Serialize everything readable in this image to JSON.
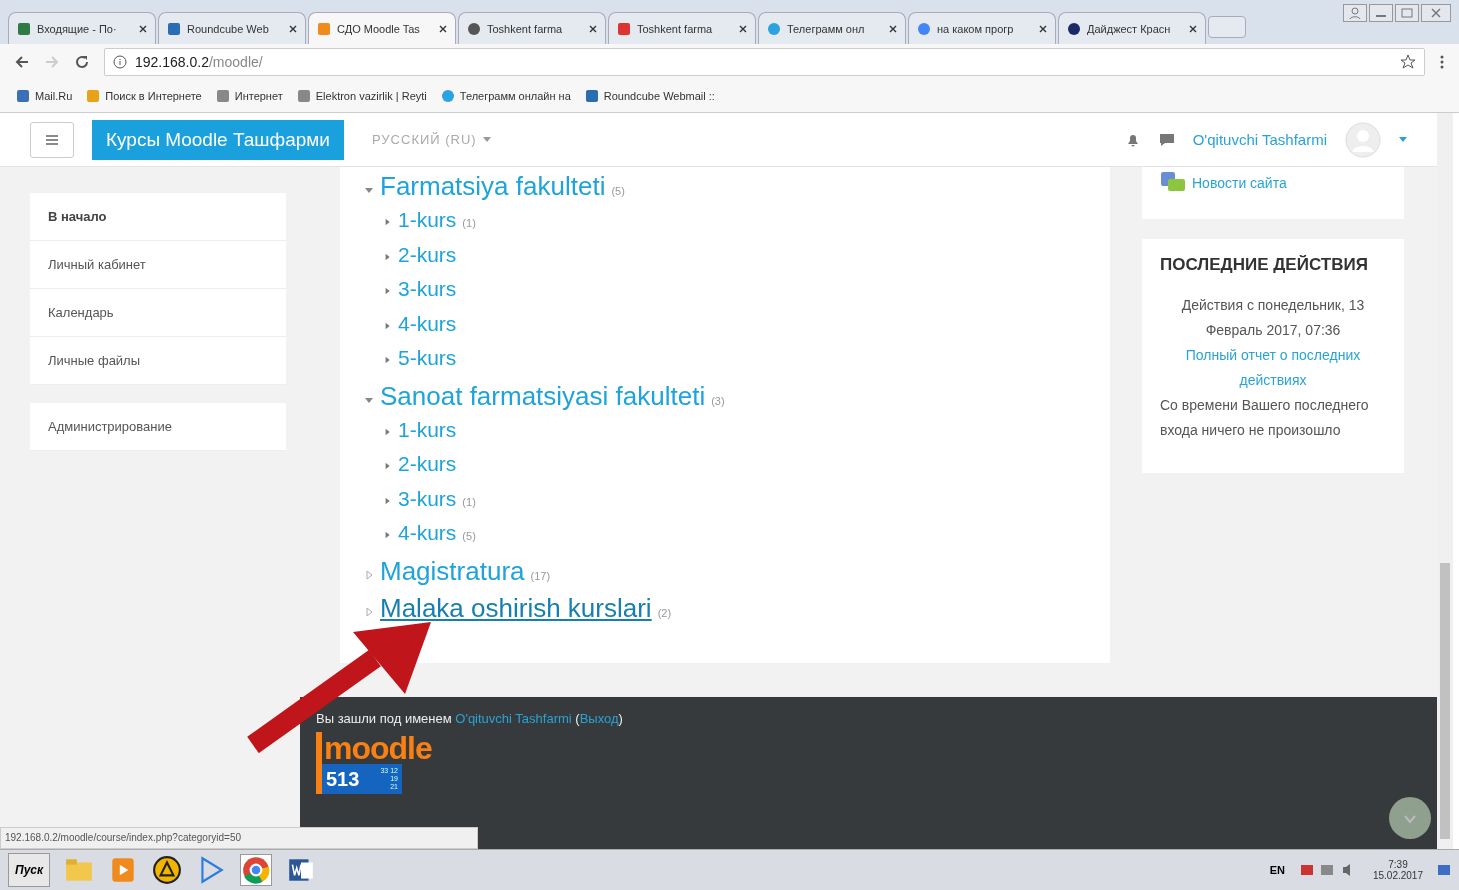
{
  "browser": {
    "tabs": [
      {
        "label": "Входящие - По·",
        "selected": false
      },
      {
        "label": "Roundcube Web",
        "selected": false
      },
      {
        "label": "СДО Moodle Tas",
        "selected": true
      },
      {
        "label": "Toshkent farma",
        "selected": false
      },
      {
        "label": "Toshkent farma",
        "selected": false
      },
      {
        "label": "Телеграмм онл",
        "selected": false
      },
      {
        "label": "на каком прогр",
        "selected": false
      },
      {
        "label": "Дайджест Красн",
        "selected": false
      }
    ],
    "url_host": "192.168.0.2",
    "url_path": "/moodle/",
    "bookmarks": [
      {
        "label": "Mail.Ru"
      },
      {
        "label": "Поиск в Интернете"
      },
      {
        "label": "Интернет"
      },
      {
        "label": "Elektron vazirlik | Reyti"
      },
      {
        "label": "Телеграмм онлайн на"
      },
      {
        "label": "Roundcube Webmail ::"
      }
    ],
    "status_url": "192.168.0.2/moodle/course/index.php?categoryid=50"
  },
  "navbar": {
    "site_name": "Курсы Moodle Ташфарми",
    "language": "РУССКИЙ (RU)",
    "user_name": "O'qituvchi Tashfarmi"
  },
  "sidebar": {
    "items": [
      {
        "label": "В начало",
        "bold": true
      },
      {
        "label": "Личный кабинет",
        "bold": false
      },
      {
        "label": "Календарь",
        "bold": false
      },
      {
        "label": "Личные файлы",
        "bold": false
      }
    ],
    "admin": "Администрирование"
  },
  "categories": [
    {
      "name": "Farmatsiya fakulteti",
      "count": "(5)",
      "expanded": true,
      "hovered": false,
      "children": [
        {
          "name": "1-kurs",
          "count": "(1)",
          "hovered": false
        },
        {
          "name": "2-kurs",
          "hovered": false
        },
        {
          "name": "3-kurs",
          "hovered": false
        },
        {
          "name": "4-kurs",
          "hovered": false
        },
        {
          "name": "5-kurs",
          "hovered": false
        }
      ]
    },
    {
      "name": "Sanoat farmatsiyasi fakulteti",
      "count": "(3)",
      "expanded": true,
      "hovered": false,
      "children": [
        {
          "name": "1-kurs",
          "hovered": false
        },
        {
          "name": "2-kurs",
          "hovered": false
        },
        {
          "name": "3-kurs",
          "count": "(1)",
          "hovered": false
        },
        {
          "name": "4-kurs",
          "count": "(5)",
          "hovered": false
        }
      ]
    },
    {
      "name": "Magistratura",
      "count": "(17)",
      "expanded": false,
      "hovered": false
    },
    {
      "name": "Malaka oshirish kurslari",
      "count": "(2)",
      "expanded": false,
      "hovered": true
    }
  ],
  "right": {
    "news_link": "Новости сайта",
    "recent": {
      "title": "ПОСЛЕДНИЕ ДЕЙСТВИЯ",
      "since": "Действия с понедельник, 13 Февраль 2017, 07:36",
      "report_link": "Полный отчет о последних действиях",
      "empty": "Со времени Вашего последнего входа ничего не произошло"
    }
  },
  "footer": {
    "logged_in": "Вы зашли под именем",
    "user_link": "O'qituvchi Tashfarmi",
    "paren_open": "(",
    "logout": "Выход",
    "paren_close": ")",
    "logo": "moodle",
    "counter": "513",
    "counter_small": [
      "33 12",
      "19",
      "21"
    ]
  },
  "taskbar": {
    "start": "Пуск",
    "lang": "EN",
    "time": "7:39",
    "date": "15.02.2017"
  }
}
